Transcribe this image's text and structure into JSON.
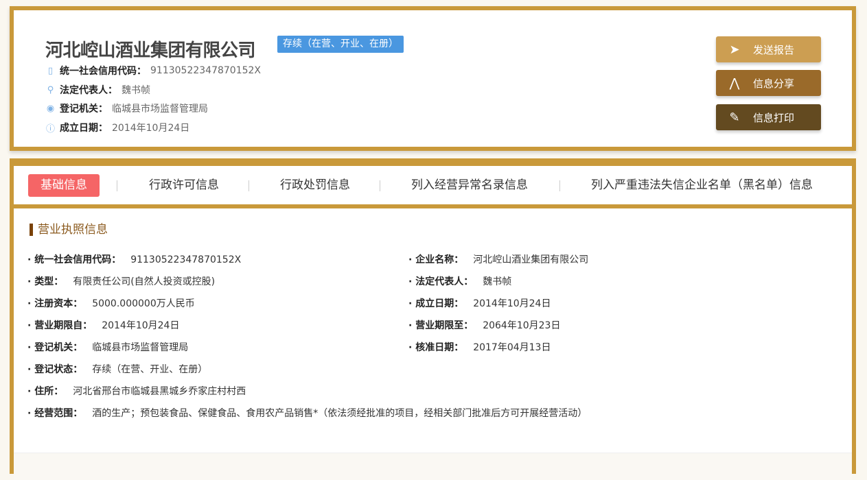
{
  "header": {
    "company_name": "河北崆山酒业集团有限公司",
    "status_badge": "存续（在营、开业、在册）",
    "meta": [
      {
        "label": "统一社会信用代码：",
        "value": "91130522347870152X",
        "icon": "book-icon"
      },
      {
        "label": "法定代表人：",
        "value": "魏书帧",
        "icon": "user-icon"
      },
      {
        "label": "登记机关：",
        "value": " 临城县市场监督管理局",
        "icon": "location-icon"
      },
      {
        "label": "成立日期：",
        "value": "2014年10月24日",
        "icon": "info-icon"
      }
    ]
  },
  "actions": [
    {
      "label": "发送报告",
      "icon": "paper-plane-icon",
      "color": "#cc9e52"
    },
    {
      "label": "信息分享",
      "icon": "share-icon",
      "color": "#9a6a2a"
    },
    {
      "label": "信息打印",
      "icon": "pencil-icon",
      "color": "#634a20"
    }
  ],
  "tabs": [
    "基础信息",
    "行政许可信息",
    "行政处罚信息",
    "列入经营异常名录信息",
    "列入严重违法失信企业名单（黑名单）信息"
  ],
  "section": {
    "title": "营业执照信息",
    "left": [
      {
        "label": "统一社会信用代码：",
        "value": "91130522347870152X"
      },
      {
        "label": "类型：",
        "value": "有限责任公司(自然人投资或控股)"
      },
      {
        "label": "注册资本：",
        "value": "5000.000000万人民币"
      },
      {
        "label": "营业期限自：",
        "value": "2014年10月24日"
      },
      {
        "label": "登记机关：",
        "value": "临城县市场监督管理局"
      },
      {
        "label": "登记状态：",
        "value": "存续（在营、开业、在册）"
      },
      {
        "label": "住所：",
        "value": "河北省邢台市临城县黑城乡乔家庄村村西"
      },
      {
        "label": "经营范围：",
        "value": "酒的生产；预包装食品、保健食品、食用农产品销售*（依法须经批准的项目，经相关部门批准后方可开展经营活动）"
      }
    ],
    "right": [
      {
        "label": "企业名称：",
        "value": "河北崆山酒业集团有限公司"
      },
      {
        "label": "法定代表人：",
        "value": "魏书帧"
      },
      {
        "label": "成立日期：",
        "value": "2014年10月24日"
      },
      {
        "label": "营业期限至：",
        "value": "2064年10月23日"
      },
      {
        "label": "核准日期：",
        "value": "2017年04月13日"
      }
    ]
  }
}
